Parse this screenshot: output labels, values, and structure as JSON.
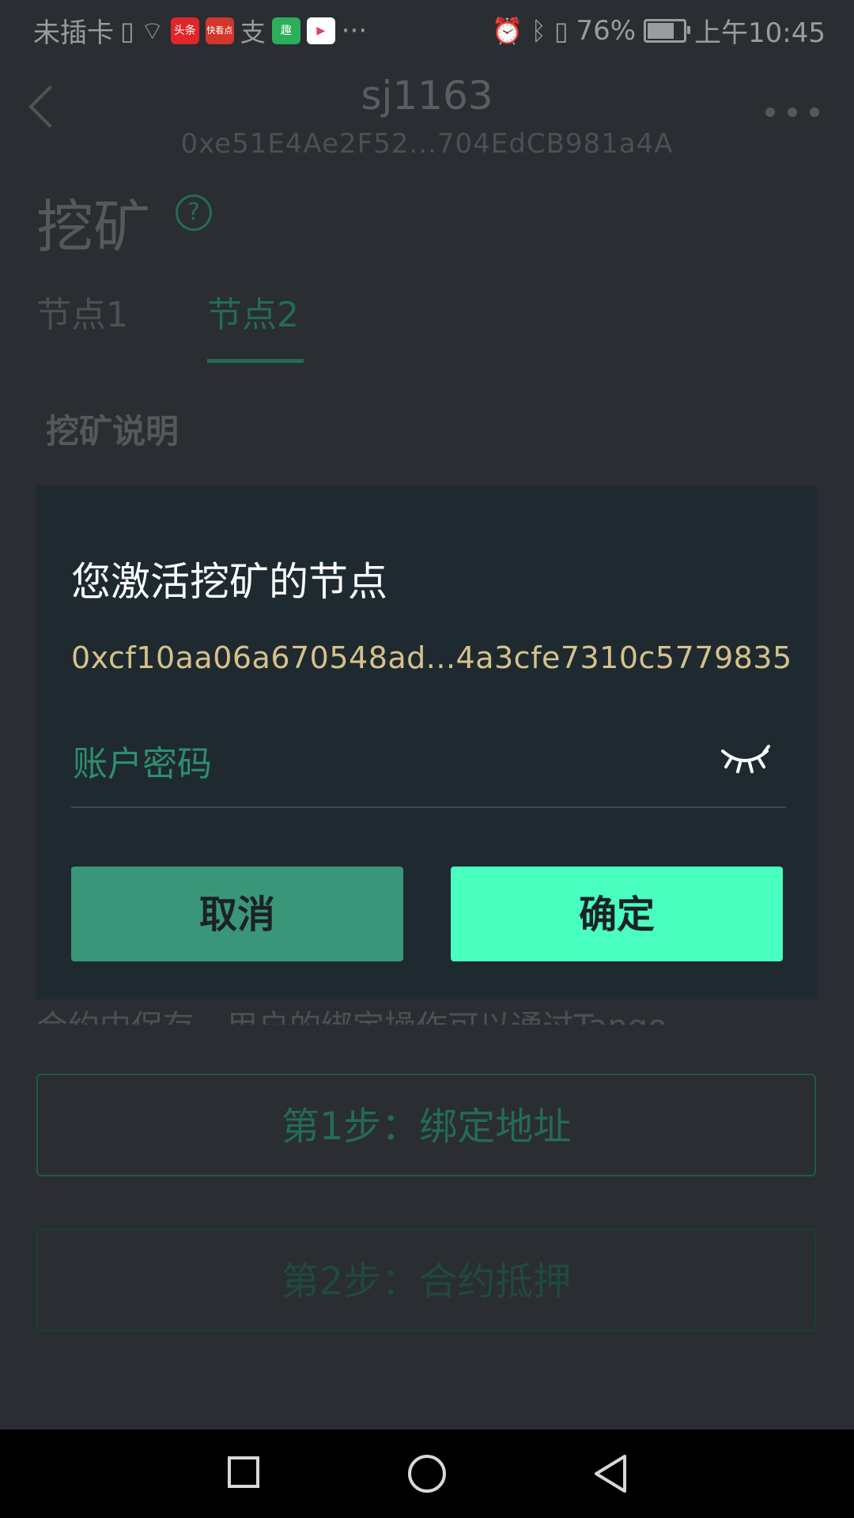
{
  "status_bar": {
    "carrier": "未插卡",
    "badge_1": "头条",
    "badge_2": "快看点",
    "badge_3": "趣",
    "more": "···",
    "battery_percent": "76%",
    "battery_level": 0.76,
    "time": "上午10:45"
  },
  "header": {
    "wallet_name": "sj1163",
    "wallet_address": "0xe51E4Ae2F52...704EdCB981a4A"
  },
  "page": {
    "title": "挖矿",
    "help_glyph": "?",
    "tabs": [
      {
        "label": "节点1",
        "active": false
      },
      {
        "label": "节点2",
        "active": true
      }
    ],
    "section_title": "挖矿说明",
    "behind_text": "合约中保存，用户的绑定操作可以通过Tango",
    "step1_label": "第1步：绑定地址",
    "step2_label": "第2步：合约抵押"
  },
  "dialog": {
    "title": "您激活挖矿的节点",
    "node_address": "0xcf10aa06a670548ad...4a3cfe7310c5779835",
    "password_placeholder": "账户密码",
    "password_value": "",
    "cancel_label": "取消",
    "confirm_label": "确定"
  },
  "colors": {
    "accent": "#49ffc0",
    "cancel": "#3a9678",
    "address": "#d6c18c",
    "dialog_bg": "#1e2a2f"
  }
}
